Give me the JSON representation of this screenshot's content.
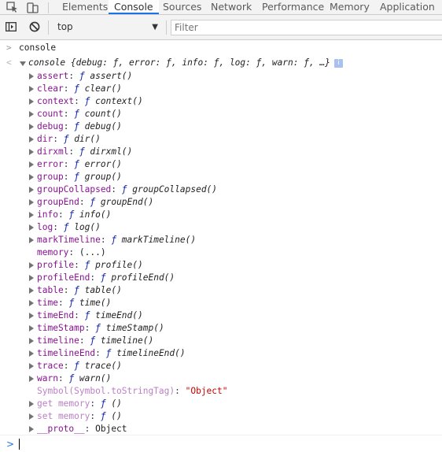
{
  "tabs": [
    {
      "label": "Elements",
      "active": false
    },
    {
      "label": "Console",
      "active": true
    },
    {
      "label": "Sources",
      "active": false
    },
    {
      "label": "Network",
      "active": false
    },
    {
      "label": "Performance",
      "active": false
    },
    {
      "label": "Memory",
      "active": false
    },
    {
      "label": "Application",
      "active": false
    }
  ],
  "toolbar": {
    "context_value": "top",
    "filter_placeholder": "Filter",
    "icons": [
      "show-sidebar-icon",
      "clear-console-icon",
      "dropdown-arrow-icon"
    ]
  },
  "console": {
    "prompt_glyph": ">",
    "result_glyph": "<",
    "command": "console",
    "object_summary": "console {debug: ƒ, error: ƒ, info: ƒ, log: ƒ, warn: ƒ, …}",
    "info_badge": "i",
    "entries": [
      {
        "key": "assert",
        "value": "assert()",
        "type": "function",
        "expandable": true
      },
      {
        "key": "clear",
        "value": "clear()",
        "type": "function",
        "expandable": true
      },
      {
        "key": "context",
        "value": "context()",
        "type": "function",
        "expandable": true
      },
      {
        "key": "count",
        "value": "count()",
        "type": "function",
        "expandable": true
      },
      {
        "key": "debug",
        "value": "debug()",
        "type": "function",
        "expandable": true
      },
      {
        "key": "dir",
        "value": "dir()",
        "type": "function",
        "expandable": true
      },
      {
        "key": "dirxml",
        "value": "dirxml()",
        "type": "function",
        "expandable": true
      },
      {
        "key": "error",
        "value": "error()",
        "type": "function",
        "expandable": true
      },
      {
        "key": "group",
        "value": "group()",
        "type": "function",
        "expandable": true
      },
      {
        "key": "groupCollapsed",
        "value": "groupCollapsed()",
        "type": "function",
        "expandable": true
      },
      {
        "key": "groupEnd",
        "value": "groupEnd()",
        "type": "function",
        "expandable": true
      },
      {
        "key": "info",
        "value": "info()",
        "type": "function",
        "expandable": true
      },
      {
        "key": "log",
        "value": "log()",
        "type": "function",
        "expandable": true
      },
      {
        "key": "markTimeline",
        "value": "markTimeline()",
        "type": "function",
        "expandable": true
      },
      {
        "key": "memory",
        "value": "(...)",
        "type": "getter",
        "expandable": false
      },
      {
        "key": "profile",
        "value": "profile()",
        "type": "function",
        "expandable": true
      },
      {
        "key": "profileEnd",
        "value": "profileEnd()",
        "type": "function",
        "expandable": true
      },
      {
        "key": "table",
        "value": "table()",
        "type": "function",
        "expandable": true
      },
      {
        "key": "time",
        "value": "time()",
        "type": "function",
        "expandable": true
      },
      {
        "key": "timeEnd",
        "value": "timeEnd()",
        "type": "function",
        "expandable": true
      },
      {
        "key": "timeStamp",
        "value": "timeStamp()",
        "type": "function",
        "expandable": true
      },
      {
        "key": "timeline",
        "value": "timeline()",
        "type": "function",
        "expandable": true
      },
      {
        "key": "timelineEnd",
        "value": "timelineEnd()",
        "type": "function",
        "expandable": true
      },
      {
        "key": "trace",
        "value": "trace()",
        "type": "function",
        "expandable": true
      },
      {
        "key": "warn",
        "value": "warn()",
        "type": "function",
        "expandable": true
      },
      {
        "key": "Symbol(Symbol.toStringTag)",
        "value": "\"Object\"",
        "type": "string",
        "expandable": false
      },
      {
        "key": "get memory",
        "value": "()",
        "type": "accessor",
        "expandable": true
      },
      {
        "key": "set memory",
        "value": "()",
        "type": "accessor",
        "expandable": true
      },
      {
        "key": "__proto__",
        "value": "Object",
        "type": "proto",
        "expandable": true
      }
    ]
  },
  "colors": {
    "property_key": "#881391",
    "dim_key": "#bb80c4",
    "function_marker": "#0d22aa",
    "string_value": "#c80000",
    "active_tab_underline": "#1a73e8",
    "prompt_blue": "#1a73e8"
  }
}
